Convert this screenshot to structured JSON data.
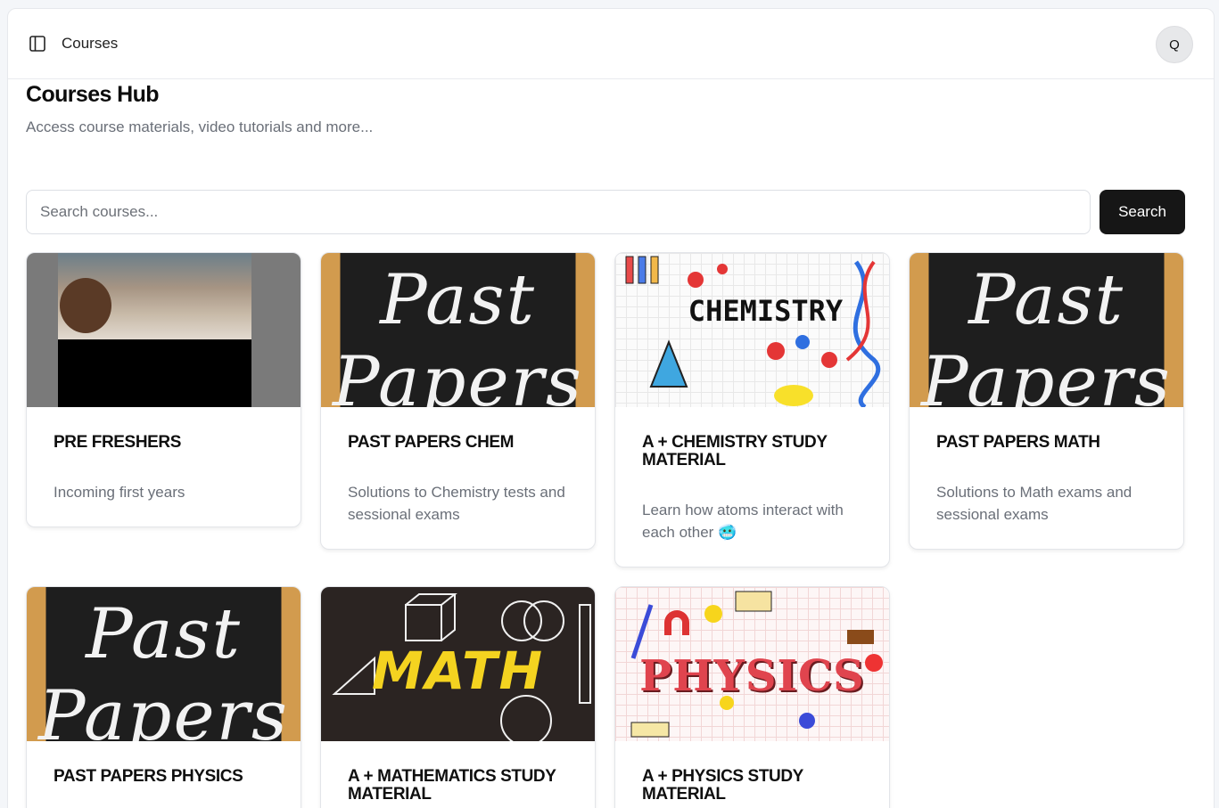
{
  "topbar": {
    "title": "Courses",
    "avatar_initial": "Q"
  },
  "header": {
    "title": "Courses Hub",
    "subtitle": "Access course materials, video tutorials and more..."
  },
  "search": {
    "placeholder": "Search courses...",
    "value": "",
    "button_label": "Search"
  },
  "courses": [
    {
      "title": "PRE FRESHERS",
      "description": "Incoming first years",
      "image": "students-photo"
    },
    {
      "title": "PAST PAPERS CHEM",
      "description": "Solutions to Chemistry tests and sessional exams",
      "image": "past-papers-chalkboard"
    },
    {
      "title": "A + CHEMISTRY STUDY MATERIAL",
      "description": "Learn how atoms interact with each other 🥶",
      "image": "chemistry-illustration",
      "image_word": "CHEMISTRY"
    },
    {
      "title": "PAST PAPERS MATH",
      "description": "Solutions to Math exams and sessional exams",
      "image": "past-papers-chalkboard"
    },
    {
      "title": "PAST PAPERS PHYSICS",
      "description": "",
      "image": "past-papers-chalkboard"
    },
    {
      "title": "A + MATHEMATICS STUDY MATERIAL",
      "description": "",
      "image": "math-chalkboard",
      "image_word": "MATH"
    },
    {
      "title": "A + PHYSICS STUDY MATERIAL",
      "description": "",
      "image": "physics-illustration",
      "image_word": "PHYSICS"
    }
  ],
  "chalk_words": {
    "line1": "Past",
    "line2": "Papers"
  },
  "colors": {
    "accent": "#161616",
    "muted_text": "#6a6f78",
    "physics_red": "#e0444e",
    "math_yellow": "#f4d320"
  }
}
